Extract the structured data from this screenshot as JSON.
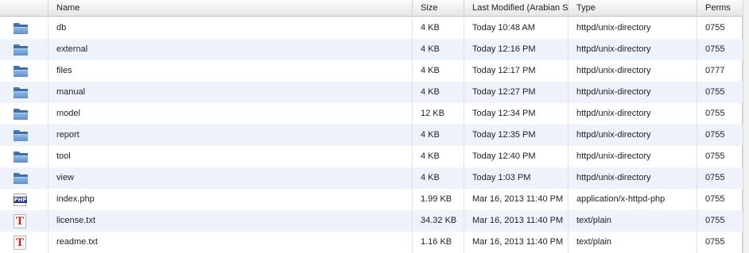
{
  "columns": {
    "name": "Name",
    "size": "Size",
    "modified": "Last Modified (Arabian St",
    "type": "Type",
    "perms": "Perms"
  },
  "files": [
    {
      "icon": "folder-icon",
      "name": "db",
      "size": "4 KB",
      "modified": "Today 10:48 AM",
      "type": "httpd/unix-directory",
      "perms": "0755"
    },
    {
      "icon": "folder-icon",
      "name": "external",
      "size": "4 KB",
      "modified": "Today 12:16 PM",
      "type": "httpd/unix-directory",
      "perms": "0755"
    },
    {
      "icon": "folder-icon",
      "name": "files",
      "size": "4 KB",
      "modified": "Today 12:17 PM",
      "type": "httpd/unix-directory",
      "perms": "0777"
    },
    {
      "icon": "folder-icon",
      "name": "manual",
      "size": "4 KB",
      "modified": "Today 12:27 PM",
      "type": "httpd/unix-directory",
      "perms": "0755"
    },
    {
      "icon": "folder-icon",
      "name": "model",
      "size": "12 KB",
      "modified": "Today 12:34 PM",
      "type": "httpd/unix-directory",
      "perms": "0755"
    },
    {
      "icon": "folder-icon",
      "name": "report",
      "size": "4 KB",
      "modified": "Today 12:35 PM",
      "type": "httpd/unix-directory",
      "perms": "0755"
    },
    {
      "icon": "folder-icon",
      "name": "tool",
      "size": "4 KB",
      "modified": "Today 12:40 PM",
      "type": "httpd/unix-directory",
      "perms": "0755"
    },
    {
      "icon": "folder-icon",
      "name": "view",
      "size": "4 KB",
      "modified": "Today 1:03 PM",
      "type": "httpd/unix-directory",
      "perms": "0755"
    },
    {
      "icon": "php-file-icon",
      "name": "index.php",
      "size": "1.99 KB",
      "modified": "Mar 16, 2013 11:40 PM",
      "type": "application/x-httpd-php",
      "perms": "0755"
    },
    {
      "icon": "text-file-icon",
      "name": "license.txt",
      "size": "34.32 KB",
      "modified": "Mar 16, 2013 11:40 PM",
      "type": "text/plain",
      "perms": "0755"
    },
    {
      "icon": "text-file-icon",
      "name": "readme.txt",
      "size": "1.16 KB",
      "modified": "Mar 16, 2013 11:40 PM",
      "type": "text/plain",
      "perms": "0755"
    }
  ],
  "icon_labels": {
    "php": "PHP",
    "text": "T"
  },
  "colors": {
    "row_alt": "#eef3fb",
    "folder": "#5f8fc9",
    "text_icon": "#c0241b"
  }
}
